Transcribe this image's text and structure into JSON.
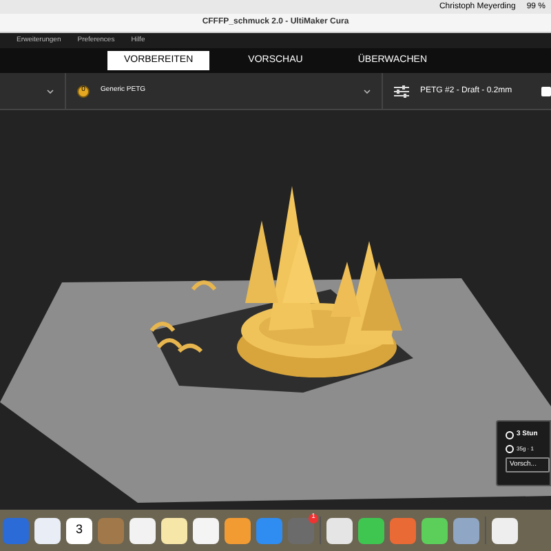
{
  "system_bar": {
    "user": "Christoph Meyerding",
    "battery": "99 %"
  },
  "window": {
    "title": "CFFFP_schmuck 2.0 - UltiMaker Cura"
  },
  "menu": [
    "Erweiterungen",
    "Preferences",
    "Hilfe"
  ],
  "tabs": [
    {
      "label": "VORBEREITEN",
      "selected": true
    },
    {
      "label": "VORSCHAU",
      "selected": false
    },
    {
      "label": "ÜBERWACHEN",
      "selected": false
    }
  ],
  "toolbar": {
    "material_badge": "0",
    "material": "Generic PETG",
    "profile": "PETG #2 - Draft - 0.2mm"
  },
  "print_info": {
    "time": "3 Stun",
    "weight": "35g · 1",
    "button": "Vorsch..."
  },
  "dock": [
    {
      "color": "#2a6bd8",
      "kind": "app"
    },
    {
      "color": "#e9eef6",
      "kind": "app"
    },
    {
      "color": "#ffffff",
      "kind": "calendar",
      "text": "3"
    },
    {
      "color": "#a0784a",
      "kind": "app"
    },
    {
      "color": "#f2f2f2",
      "kind": "app"
    },
    {
      "color": "#f6e6a8",
      "kind": "app"
    },
    {
      "color": "#f4f4f4",
      "kind": "app"
    },
    {
      "color": "#f29b33",
      "kind": "app"
    },
    {
      "color": "#2f8cf0",
      "kind": "app"
    },
    {
      "color": "#6b6b6b",
      "kind": "badge",
      "text": "1"
    },
    {
      "color": "#e5e5e5",
      "kind": "app",
      "separator": true
    },
    {
      "color": "#3fc651",
      "kind": "app"
    },
    {
      "color": "#e96a35",
      "kind": "app"
    },
    {
      "color": "#5ccf5a",
      "kind": "app"
    },
    {
      "color": "#8fa6c4",
      "kind": "app"
    },
    {
      "color": "#eeeeee",
      "kind": "app",
      "separator": true
    }
  ]
}
